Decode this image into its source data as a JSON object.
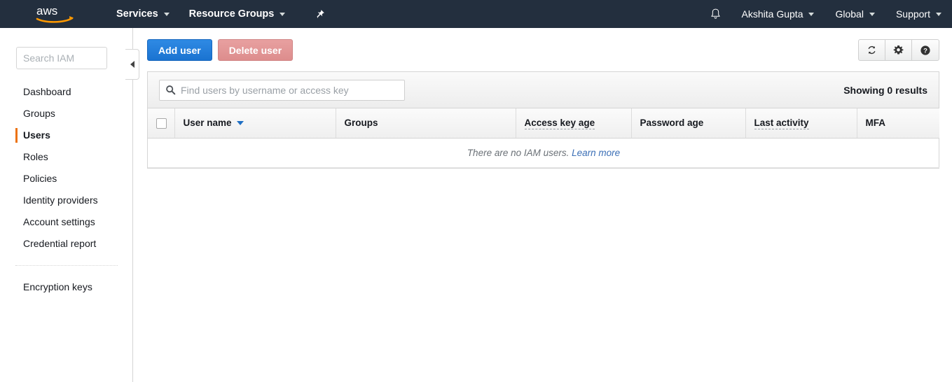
{
  "topnav": {
    "logo_alt": "aws",
    "items": [
      {
        "label": "Services",
        "caret": true
      },
      {
        "label": "Resource Groups",
        "caret": true
      }
    ],
    "pin_icon": "pushpin-icon",
    "bell_icon": "bell-icon",
    "right_items": [
      {
        "label": "Akshita Gupta",
        "caret": true
      },
      {
        "label": "Global",
        "caret": true
      },
      {
        "label": "Support",
        "caret": true
      }
    ]
  },
  "sidebar": {
    "search_placeholder": "Search IAM",
    "search_value": "",
    "items": [
      {
        "label": "Dashboard",
        "active": false
      },
      {
        "label": "Groups",
        "active": false
      },
      {
        "label": "Users",
        "active": true
      },
      {
        "label": "Roles",
        "active": false
      },
      {
        "label": "Policies",
        "active": false
      },
      {
        "label": "Identity providers",
        "active": false
      },
      {
        "label": "Account settings",
        "active": false
      },
      {
        "label": "Credential report",
        "active": false
      }
    ],
    "bottom_items": [
      {
        "label": "Encryption keys",
        "active": false
      }
    ],
    "collapse_label": "Collapse sidebar"
  },
  "toolbar": {
    "add_user_label": "Add user",
    "delete_user_label": "Delete user",
    "refresh_icon": "refresh-icon",
    "settings_icon": "gear-icon",
    "help_icon": "help-icon"
  },
  "panel": {
    "find_placeholder": "Find users by username or access key",
    "find_value": "",
    "search_icon": "search-icon",
    "results_label": "Showing 0 results",
    "columns": [
      {
        "label": "User name",
        "sortable": true,
        "tooltip": false
      },
      {
        "label": "Groups",
        "sortable": false,
        "tooltip": false
      },
      {
        "label": "Access key age",
        "sortable": false,
        "tooltip": true
      },
      {
        "label": "Password age",
        "sortable": false,
        "tooltip": false
      },
      {
        "label": "Last activity",
        "sortable": false,
        "tooltip": true
      },
      {
        "label": "MFA",
        "sortable": false,
        "tooltip": false
      }
    ],
    "empty_text": "There are no IAM users.",
    "empty_link": "Learn more"
  },
  "colors": {
    "navbar_bg": "#232f3e",
    "accent_orange": "#ec7211",
    "primary_blue": "#1a73d1",
    "danger_red": "#dd8d8d",
    "link_blue": "#3b6fb6"
  }
}
